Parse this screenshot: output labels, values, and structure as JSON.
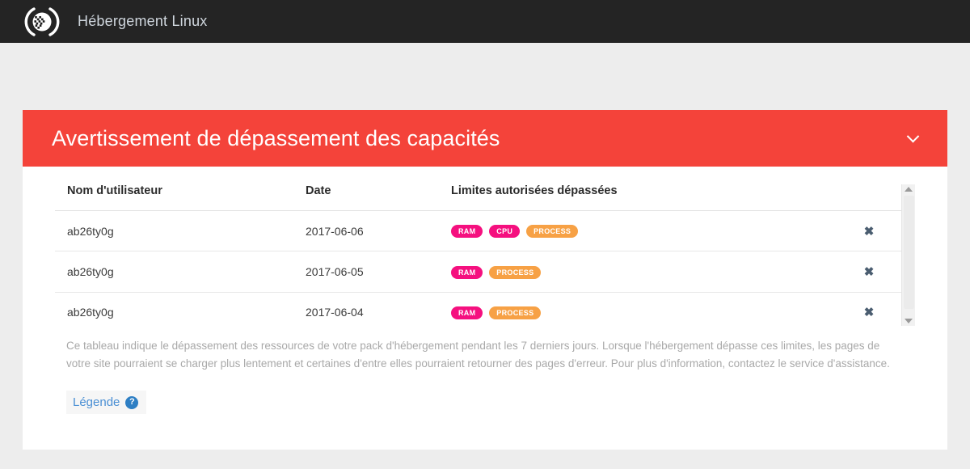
{
  "navbar": {
    "logo_icon": "globe-bracket-logo",
    "title": "Hébergement Linux"
  },
  "panel": {
    "title": "Avertissement de dépassement des capacités",
    "collapse_icon": "chevron-down-icon",
    "header_color": "#f4433a"
  },
  "table": {
    "columns": [
      "Nom d'utilisateur",
      "Date",
      "Limites autorisées dépassées",
      ""
    ],
    "rows": [
      {
        "username": "ab26ty0g",
        "date": "2017-06-06",
        "limits": [
          "RAM",
          "CPU",
          "PROCESS"
        ],
        "dismiss_icon": "close-icon",
        "dismiss_glyph": "✖"
      },
      {
        "username": "ab26ty0g",
        "date": "2017-06-05",
        "limits": [
          "RAM",
          "PROCESS"
        ],
        "dismiss_icon": "close-icon",
        "dismiss_glyph": "✖"
      },
      {
        "username": "ab26ty0g",
        "date": "2017-06-04",
        "limits": [
          "RAM",
          "PROCESS"
        ],
        "dismiss_icon": "close-icon",
        "dismiss_glyph": "✖"
      }
    ],
    "badge_colors": {
      "RAM": "#f5107f",
      "CPU": "#f5107f",
      "PROCESS": "#f7a145"
    }
  },
  "scrollbar": {
    "up_icon": "scroll-up-arrow-icon",
    "down_icon": "scroll-down-arrow-icon"
  },
  "note": "Ce tableau indique le dépassement des ressources de votre pack d'hébergement pendant les 7 derniers jours. Lorsque l'hébergement dépasse ces limites, les pages de votre site pourraient se charger plus lentement et certaines d'entre elles pourraient retourner des pages d'erreur. Pour plus d'information, contactez le service d'assistance.",
  "legend": {
    "label": "Légende",
    "help_icon": "question-circle-icon",
    "help_glyph": "?"
  }
}
